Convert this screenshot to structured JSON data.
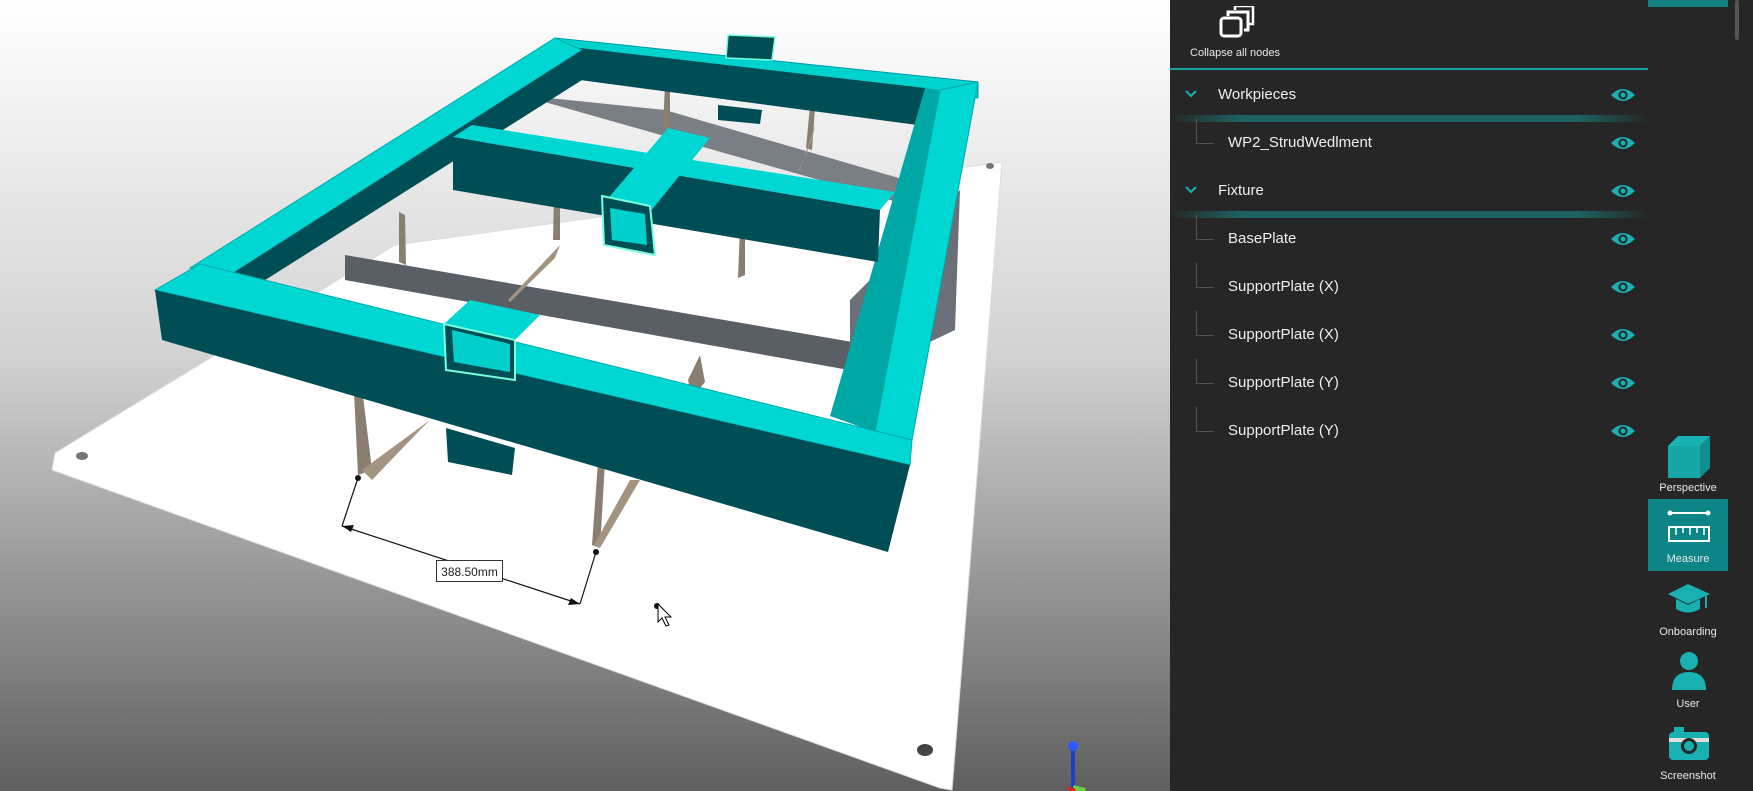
{
  "panel": {
    "collapse_label": "Collapse all nodes",
    "tree": [
      {
        "kind": "group",
        "label": "Workpieces"
      },
      {
        "kind": "child",
        "label": "WP2_StrudWedlment"
      },
      {
        "kind": "group",
        "label": "Fixture"
      },
      {
        "kind": "child",
        "label": "BasePlate"
      },
      {
        "kind": "child",
        "label": "SupportPlate (X)"
      },
      {
        "kind": "child",
        "label": "SupportPlate (X)"
      },
      {
        "kind": "child",
        "label": "SupportPlate (Y)"
      },
      {
        "kind": "child",
        "label": "SupportPlate (Y)"
      }
    ]
  },
  "toolbar": {
    "perspective": "Perspective",
    "measure": "Measure",
    "onboarding": "Onboarding",
    "user": "User",
    "screenshot": "Screenshot"
  },
  "viewport": {
    "measurement": "388.50mm"
  },
  "colors": {
    "accent": "#15a3a3",
    "frame_top": "#00d6d2",
    "frame_side": "#004e55",
    "toolbar_active": "#0d8586"
  },
  "icons": [
    "collapse-icon",
    "chevron-down-icon",
    "eye-icon",
    "cube-icon",
    "ruler-icon",
    "graduation-cap-icon",
    "user-icon",
    "camera-icon"
  ]
}
